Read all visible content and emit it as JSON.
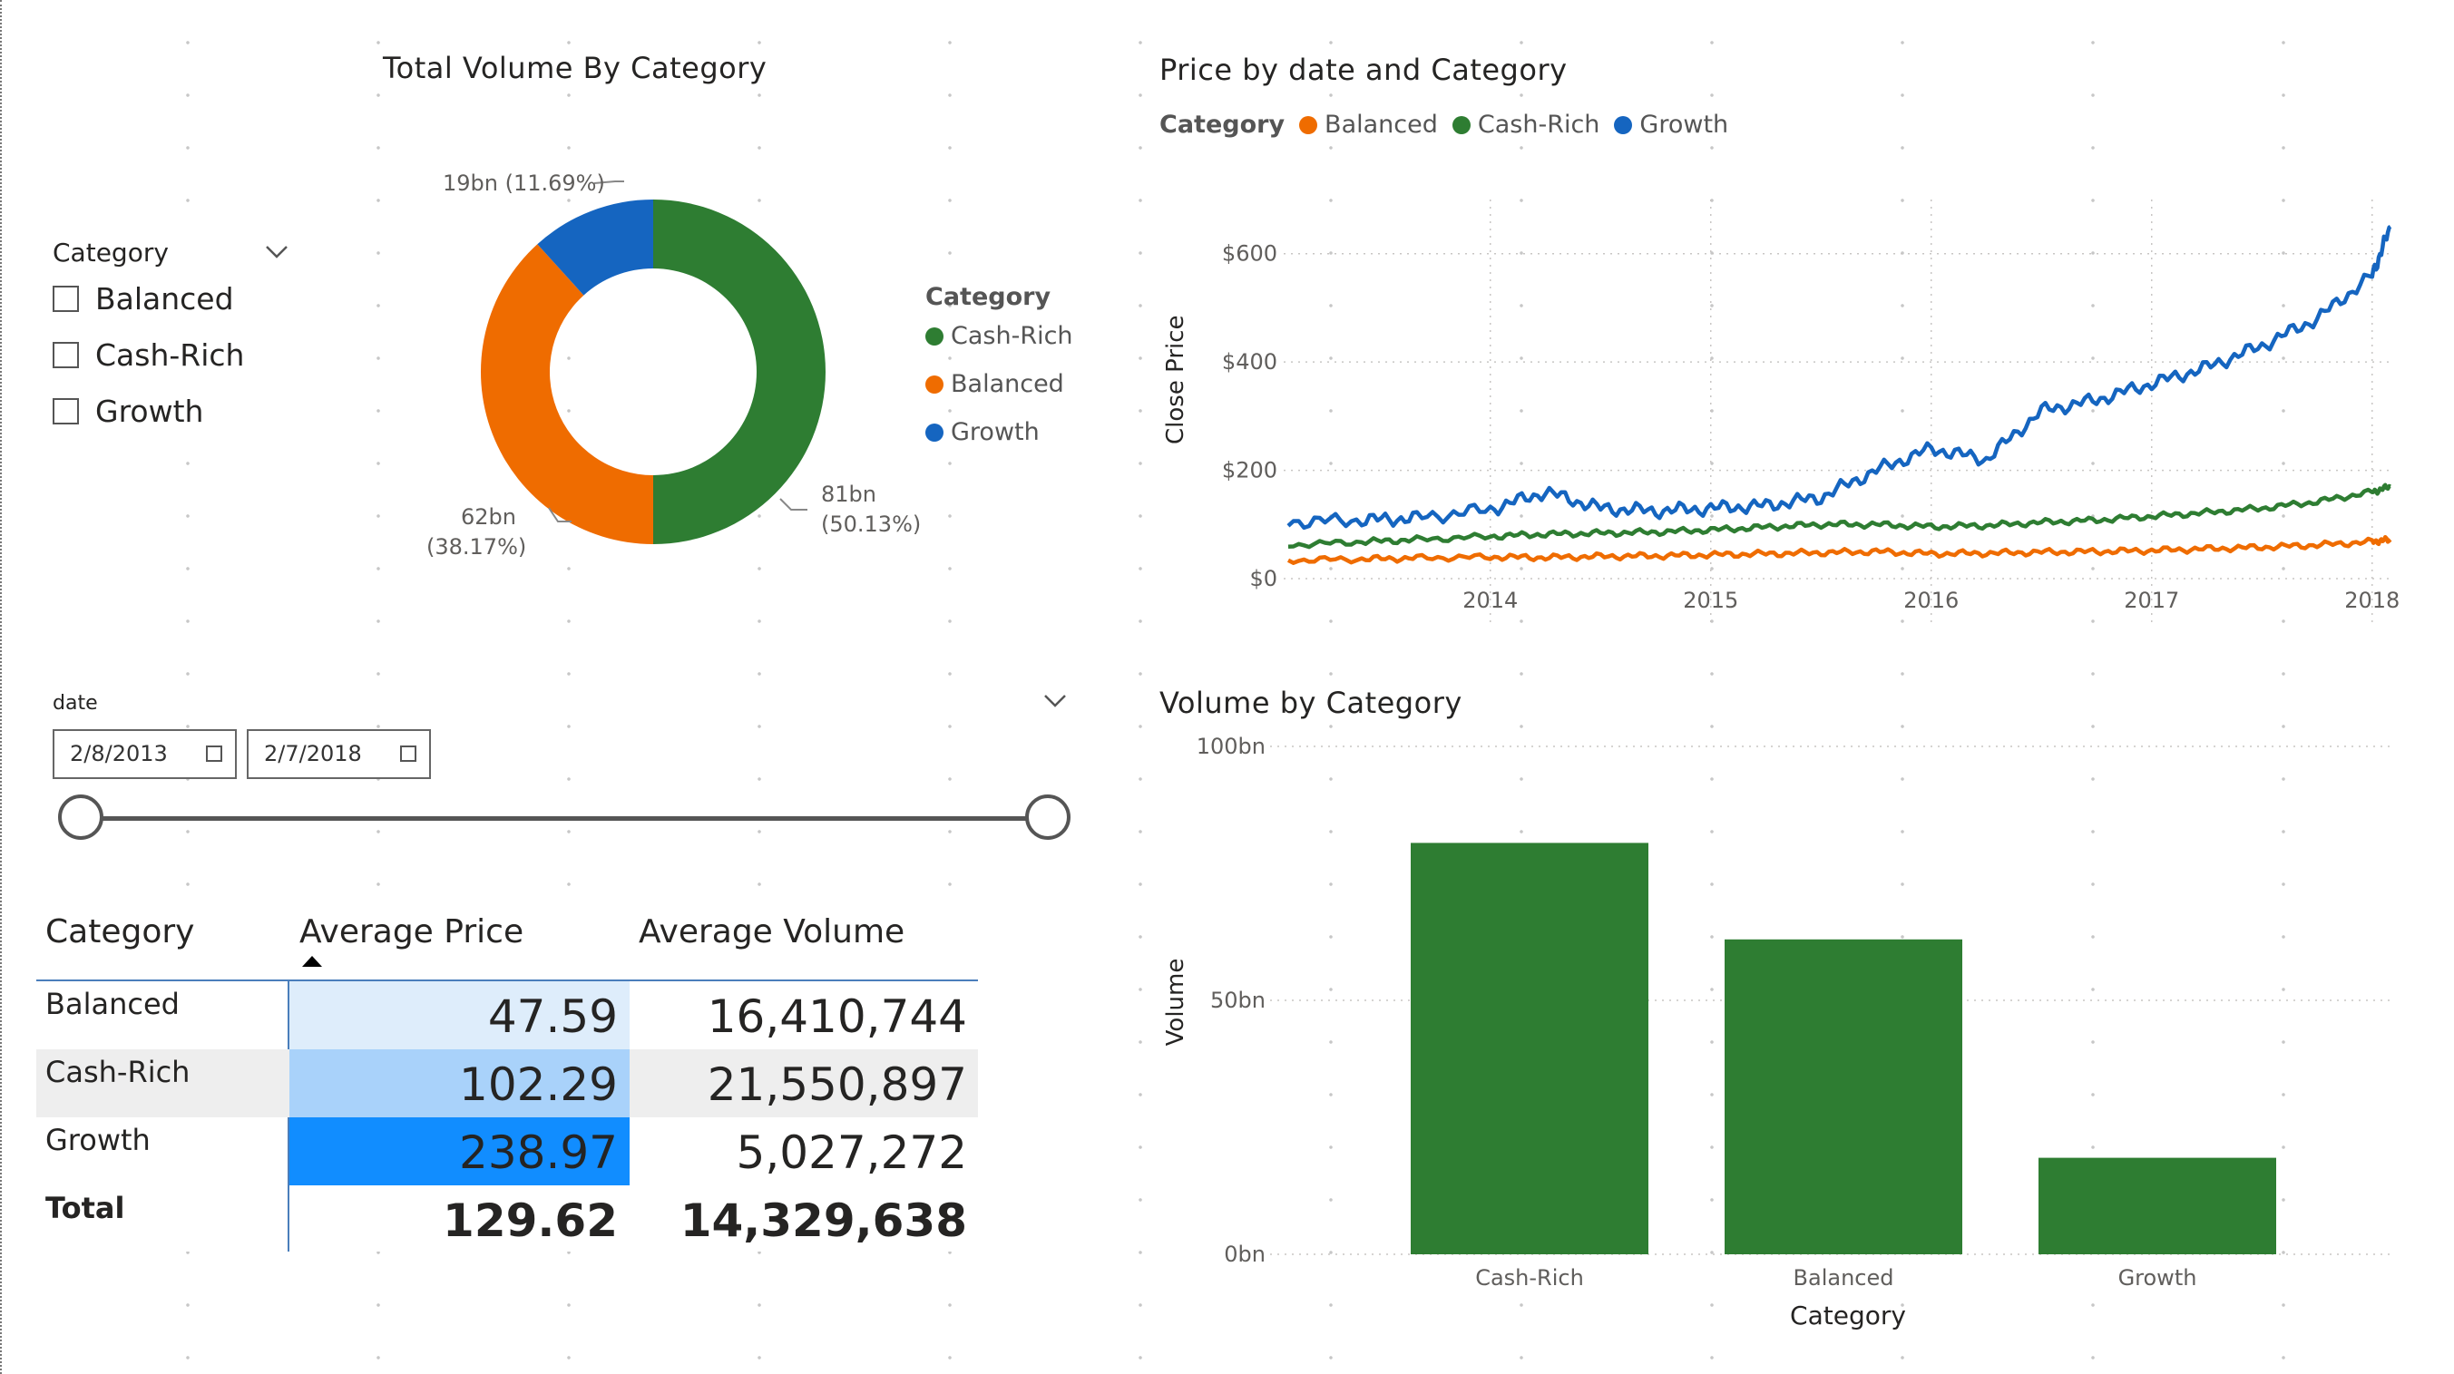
{
  "donut": {
    "title": "Total Volume By Category",
    "legend_title": "Category",
    "legend": [
      {
        "label": "Cash-Rich",
        "color": "#2e7d32"
      },
      {
        "label": "Balanced",
        "color": "#ef6c00"
      },
      {
        "label": "Growth",
        "color": "#1565c0"
      }
    ],
    "labels": {
      "growth": "19bn (11.69%)",
      "balanced_1": "62bn",
      "balanced_2": "(38.17%)",
      "cashrich_1": "81bn",
      "cashrich_2": "(50.13%)"
    }
  },
  "slicer": {
    "header": "Category",
    "options": [
      "Balanced",
      "Cash-Rich",
      "Growth"
    ]
  },
  "date_slicer": {
    "label": "date",
    "start": "2/8/2013",
    "end": "2/7/2018"
  },
  "table": {
    "headers": [
      "Category",
      "Average Price",
      "Average Volume"
    ],
    "rows": [
      {
        "category": "Balanced",
        "price": "47.59",
        "volume": "16,410,744"
      },
      {
        "category": "Cash-Rich",
        "price": "102.29",
        "volume": "21,550,897"
      },
      {
        "category": "Growth",
        "price": "238.97",
        "volume": "5,027,272"
      }
    ],
    "total": {
      "category": "Total",
      "price": "129.62",
      "volume": "14,329,638"
    }
  },
  "line_chart": {
    "title": "Price by date and Category",
    "legend_title": "Category",
    "legend": [
      {
        "label": "Balanced",
        "color": "#ef6c00"
      },
      {
        "label": "Cash-Rich",
        "color": "#2e7d32"
      },
      {
        "label": "Growth",
        "color": "#1565c0"
      }
    ],
    "ylabel": "Close Price",
    "yticks": [
      "$0",
      "$200",
      "$400",
      "$600"
    ],
    "xticks": [
      "2014",
      "2015",
      "2016",
      "2017",
      "2018"
    ]
  },
  "bar_chart": {
    "title": "Volume by Category",
    "ylabel": "Volume",
    "xlabel": "Category",
    "yticks": [
      "0bn",
      "50bn",
      "100bn"
    ],
    "color": "#2e7d32"
  },
  "chart_data": [
    {
      "type": "pie",
      "title": "Total Volume By Category",
      "categories": [
        "Cash-Rich",
        "Balanced",
        "Growth"
      ],
      "values": [
        81,
        62,
        19
      ],
      "percent": [
        50.13,
        38.17,
        11.69
      ],
      "unit": "bn"
    },
    {
      "type": "line",
      "title": "Price by date and Category",
      "xlabel": "",
      "ylabel": "Close Price",
      "ylim": [
        0,
        700
      ],
      "x": [
        "2013-02",
        "2013-06",
        "2013-09",
        "2014-01",
        "2014-04",
        "2014-07",
        "2014-10",
        "2015-01",
        "2015-04",
        "2015-07",
        "2015-10",
        "2016-01",
        "2016-04",
        "2016-07",
        "2016-10",
        "2017-01",
        "2017-04",
        "2017-07",
        "2017-10",
        "2018-01",
        "2018-02"
      ],
      "series": [
        {
          "name": "Balanced",
          "values": [
            34,
            36,
            38,
            40,
            39,
            41,
            42,
            44,
            46,
            48,
            50,
            46,
            47,
            49,
            50,
            52,
            55,
            58,
            62,
            68,
            72
          ]
        },
        {
          "name": "Cash-Rich",
          "values": [
            62,
            68,
            72,
            78,
            82,
            84,
            86,
            90,
            95,
            100,
            100,
            96,
            98,
            104,
            108,
            115,
            122,
            130,
            142,
            160,
            170
          ]
        },
        {
          "name": "Growth",
          "values": [
            105,
            108,
            112,
            128,
            160,
            130,
            125,
            130,
            135,
            150,
            200,
            240,
            220,
            310,
            330,
            360,
            390,
            430,
            480,
            560,
            650
          ]
        }
      ]
    },
    {
      "type": "bar",
      "title": "Volume by Category",
      "categories": [
        "Cash-Rich",
        "Balanced",
        "Growth"
      ],
      "values": [
        81,
        62,
        19
      ],
      "xlabel": "Category",
      "ylabel": "Volume",
      "ylim": [
        0,
        100
      ],
      "unit": "bn"
    }
  ]
}
